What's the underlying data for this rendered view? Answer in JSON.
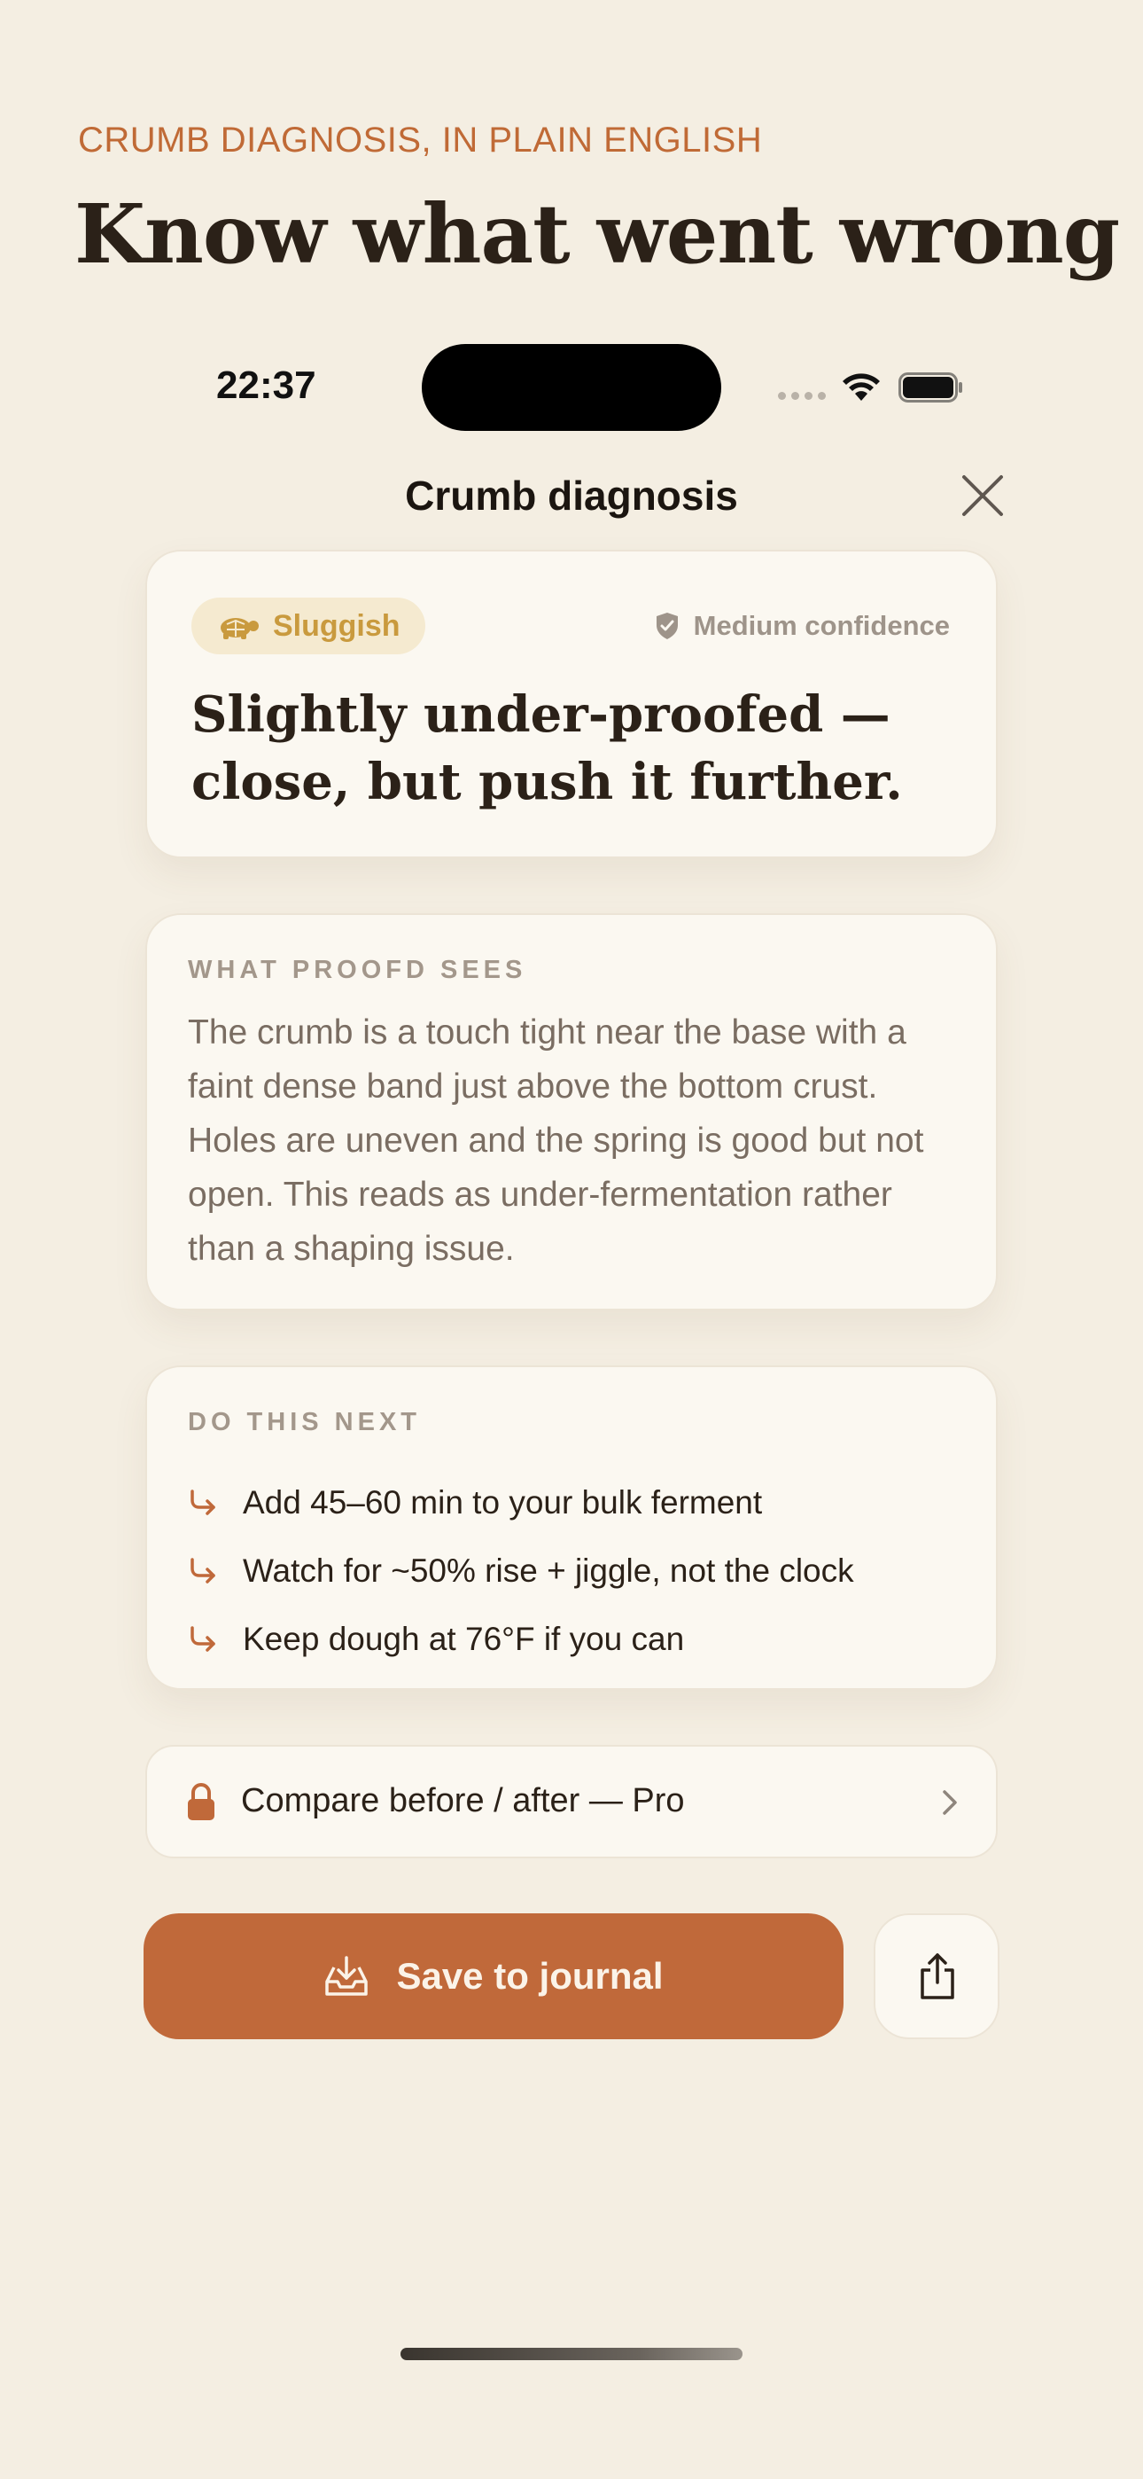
{
  "header": {
    "eyebrow": "CRUMB DIAGNOSIS, IN PLAIN ENGLISH",
    "headline": "Know what went wrong"
  },
  "status_bar": {
    "time": "22:37"
  },
  "nav": {
    "title": "Crumb diagnosis",
    "close_icon": "close-icon"
  },
  "verdict": {
    "badge_icon": "turtle-icon",
    "badge_label": "Sluggish",
    "confidence_icon": "shield-icon",
    "confidence_label": "Medium confidence",
    "title": "Slightly under-proofed — close, but push it further."
  },
  "sees": {
    "label": "WHAT PROOFD SEES",
    "text": "The crumb is a touch tight near the base with a faint dense band just above the bottom crust. Holes are uneven and the spring is good but not open. This reads as under-fermentation rather than a shaping issue."
  },
  "next": {
    "label": "DO THIS NEXT",
    "steps": [
      "Add 45–60 min to your bulk ferment",
      "Watch for ~50% rise + jiggle, not the clock",
      "Keep dough at 76°F if you can"
    ]
  },
  "compare": {
    "icon": "lock-icon",
    "label": "Compare before / after — Pro"
  },
  "actions": {
    "save_icon": "tray-icon",
    "save_label": "Save to journal",
    "share_icon": "share-icon"
  },
  "colors": {
    "background": "#f4eee2",
    "accent": "#c0693a",
    "card": "#fbf8f1",
    "badge_bg": "#f5ead0",
    "badge_text": "#c99a3e"
  }
}
